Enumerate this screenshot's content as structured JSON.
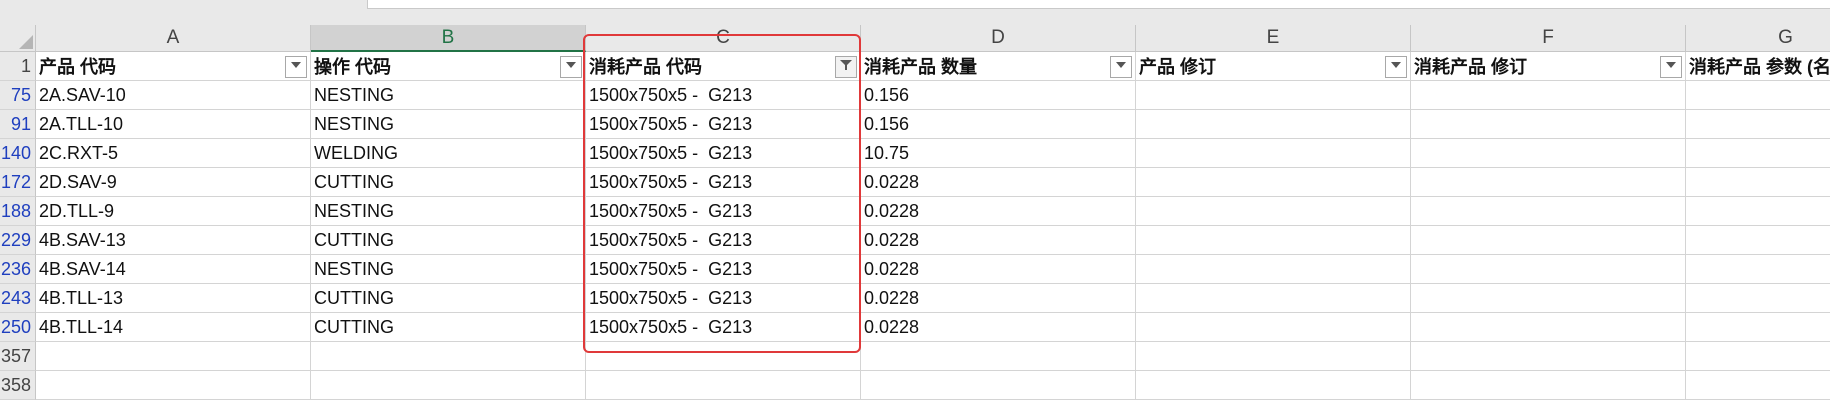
{
  "columns": [
    "A",
    "B",
    "C",
    "D",
    "E",
    "F",
    "G"
  ],
  "header_row_number": "1",
  "headers": [
    "产品 代码",
    "操作 代码",
    "消耗产品 代码",
    "消耗产品 数量",
    "产品 修订",
    "消耗产品 修订",
    "消耗产品 参数 (名"
  ],
  "rows": [
    {
      "num": "75",
      "a": "2A.SAV-10",
      "b": "NESTING",
      "c": "1500x750x5 -  G213",
      "d": "0.156"
    },
    {
      "num": "91",
      "a": "2A.TLL-10",
      "b": "NESTING",
      "c": "1500x750x5 -  G213",
      "d": "0.156"
    },
    {
      "num": "140",
      "a": "2C.RXT-5",
      "b": "WELDING",
      "c": "1500x750x5 -  G213",
      "d": "10.75"
    },
    {
      "num": "172",
      "a": "2D.SAV-9",
      "b": "CUTTING",
      "c": "1500x750x5 -  G213",
      "d": "0.0228"
    },
    {
      "num": "188",
      "a": "2D.TLL-9",
      "b": "NESTING",
      "c": "1500x750x5 -  G213",
      "d": "0.0228"
    },
    {
      "num": "229",
      "a": "4B.SAV-13",
      "b": "CUTTING",
      "c": "1500x750x5 -  G213",
      "d": "0.0228"
    },
    {
      "num": "236",
      "a": "4B.SAV-14",
      "b": "NESTING",
      "c": "1500x750x5 -  G213",
      "d": "0.0228"
    },
    {
      "num": "243",
      "a": "4B.TLL-13",
      "b": "CUTTING",
      "c": "1500x750x5 -  G213",
      "d": "0.0228"
    },
    {
      "num": "250",
      "a": "4B.TLL-14",
      "b": "CUTTING",
      "c": "1500x750x5 -  G213",
      "d": "0.0228"
    }
  ],
  "empty_rows": [
    "357",
    "358"
  ],
  "selected_column": "B",
  "filtered_column": "C",
  "colors": {
    "highlight": "#e0393a",
    "accent": "#217346",
    "row_link": "#1f3fbf"
  }
}
